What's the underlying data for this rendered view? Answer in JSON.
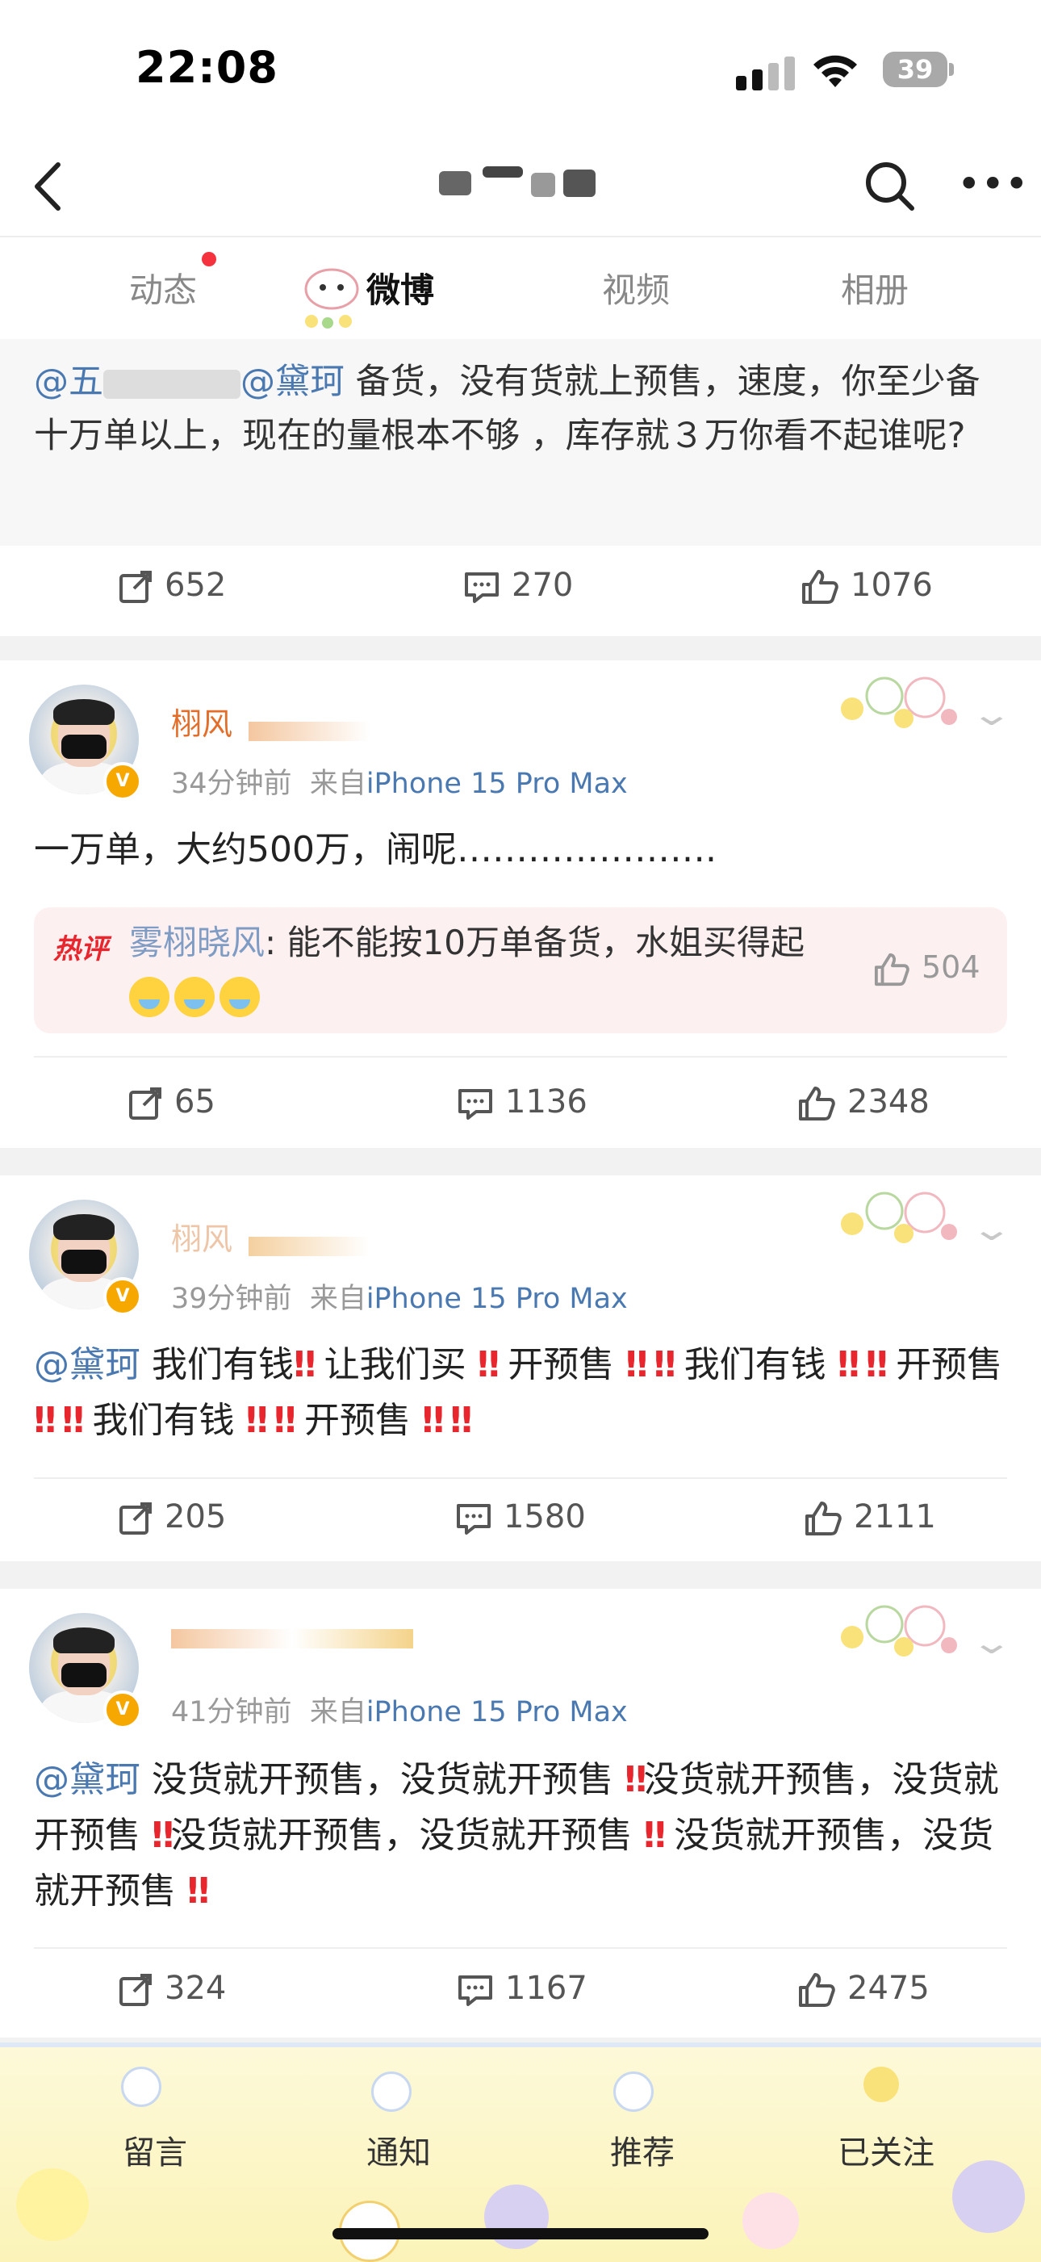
{
  "status_bar": {
    "time": "22:08",
    "battery": "39"
  },
  "tabs": [
    {
      "label": "动态",
      "has_dot": true
    },
    {
      "label": "微博",
      "active": true
    },
    {
      "label": "视频"
    },
    {
      "label": "相册"
    }
  ],
  "quote": {
    "mention1": "@五",
    "mention2": "@黛珂",
    "text": "备货，没有货就上预售，速度，你至少备十万单以上，现在的量根本不够 ，库存就３万你看不起谁呢?"
  },
  "quote_actions": {
    "reposts": "652",
    "comments": "270",
    "likes": "1076"
  },
  "posts": [
    {
      "name_visible": "栩风",
      "time": "34分钟前",
      "source_prefix": "来自",
      "source": "iPhone 15 Pro Max",
      "text": "一万单，大约500万，闹呢………………….",
      "hot_comment": {
        "tag": "热评",
        "author": "雾栩晓风",
        "text": ": 能不能按10万单备货，水姐买得起",
        "likes": "504"
      },
      "actions": {
        "reposts": "65",
        "comments": "1136",
        "likes": "2348"
      }
    },
    {
      "name_visible": "栩风",
      "time": "39分钟前",
      "source_prefix": "来自",
      "source": "iPhone 15 Pro Max",
      "mention": "@黛珂",
      "segments": [
        "我们有钱",
        "让我们买",
        "开预售",
        "我们有钱",
        "开预售",
        "我们有钱",
        "开预售"
      ],
      "actions": {
        "reposts": "205",
        "comments": "1580",
        "likes": "2111"
      }
    },
    {
      "name_visible": "",
      "time": "41分钟前",
      "source_prefix": "来自",
      "source": "iPhone 15 Pro Max",
      "mention": "@黛珂",
      "segments": [
        "没货就开预售，没货就开预售",
        "没货就开预售，没货就开预售",
        "没货就开预售，没货就开预售",
        "没货就开预售，没货就开预售"
      ],
      "actions": {
        "reposts": "324",
        "comments": "1167",
        "likes": "2475"
      }
    }
  ],
  "bottom_tabs": [
    "留言",
    "通知",
    "推荐",
    "已关注"
  ],
  "colors": {
    "link": "#4a79b2",
    "hot": "#e8262e",
    "badge": "#f6a800"
  }
}
